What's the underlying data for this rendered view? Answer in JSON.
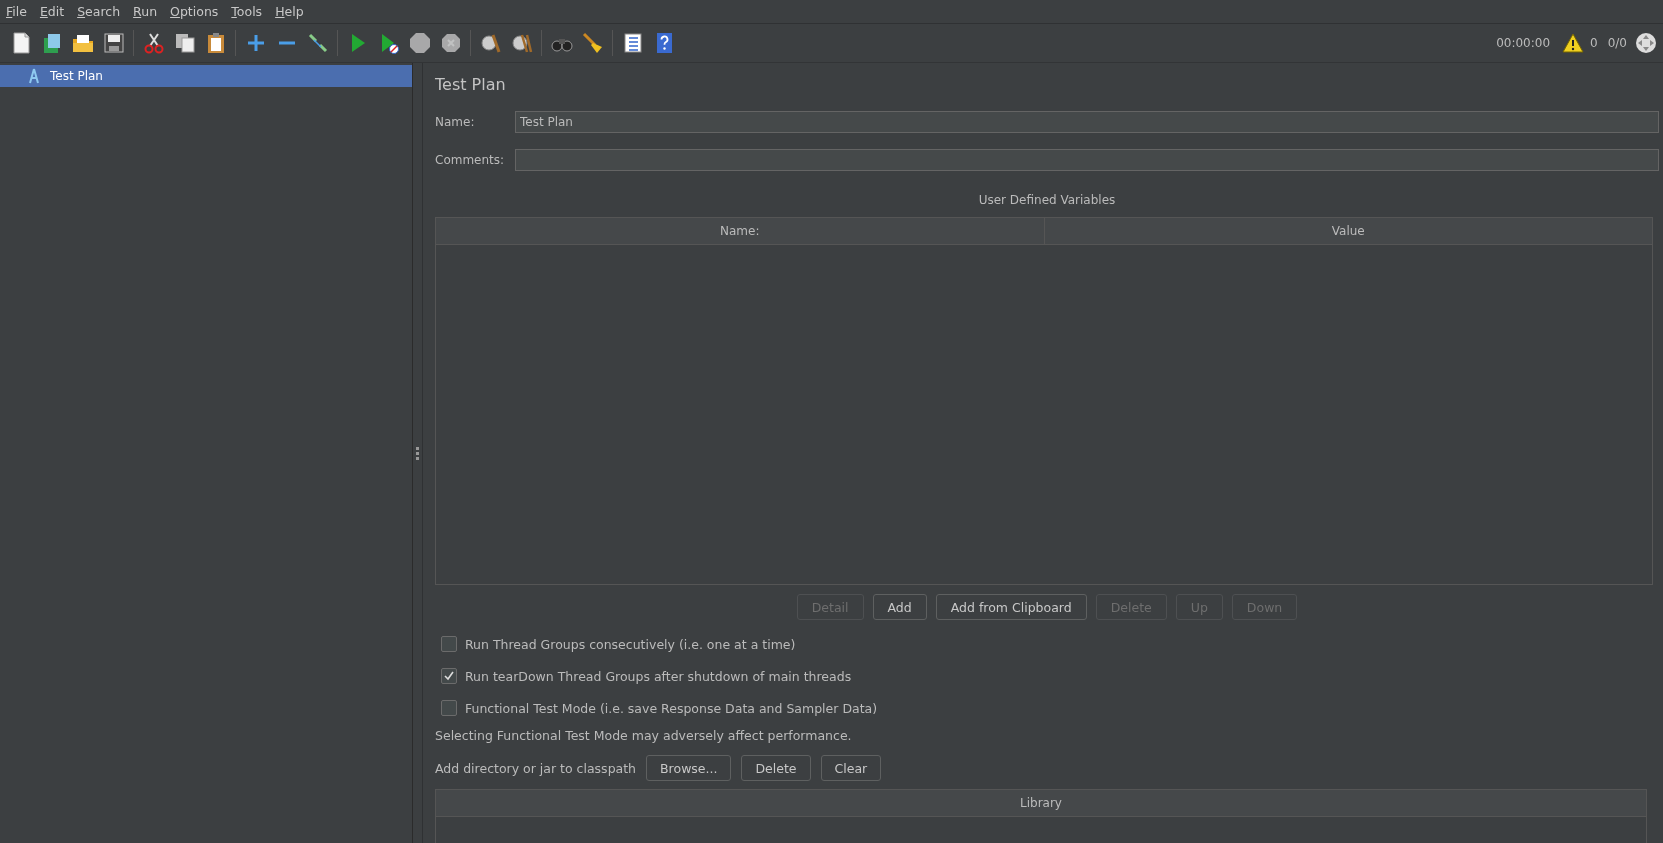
{
  "menu": [
    {
      "label": "File"
    },
    {
      "label": "Edit"
    },
    {
      "label": "Search"
    },
    {
      "label": "Run"
    },
    {
      "label": "Options"
    },
    {
      "label": "Tools"
    },
    {
      "label": "Help"
    }
  ],
  "toolbar": [
    [
      {
        "kind": "new",
        "disabled": false
      },
      {
        "kind": "templates",
        "disabled": false
      },
      {
        "kind": "open",
        "disabled": false
      },
      {
        "kind": "save",
        "disabled": false
      }
    ],
    [
      {
        "kind": "cut",
        "disabled": false
      },
      {
        "kind": "copy",
        "disabled": false
      },
      {
        "kind": "paste",
        "disabled": false
      }
    ],
    [
      {
        "kind": "expand",
        "disabled": false
      },
      {
        "kind": "collapse",
        "disabled": false
      },
      {
        "kind": "toggle",
        "disabled": false
      }
    ],
    [
      {
        "kind": "start",
        "disabled": false
      },
      {
        "kind": "start-no-timers",
        "disabled": false
      },
      {
        "kind": "stop",
        "disabled": true
      },
      {
        "kind": "shutdown",
        "disabled": true
      }
    ],
    [
      {
        "kind": "clear",
        "disabled": false
      },
      {
        "kind": "clear-all",
        "disabled": false
      }
    ],
    [
      {
        "kind": "search",
        "disabled": false
      },
      {
        "kind": "reset-search",
        "disabled": false
      }
    ],
    [
      {
        "kind": "function-helper",
        "disabled": false
      },
      {
        "kind": "help",
        "disabled": false
      }
    ]
  ],
  "status": {
    "timer": "00:00:00",
    "warnings": "0",
    "threads": "0/0"
  },
  "tree": [
    {
      "label": "Test Plan",
      "selected": true
    }
  ],
  "panel": {
    "title": "Test Plan",
    "name_field": {
      "label": "Name:",
      "value": "Test Plan"
    },
    "comments_field": {
      "label": "Comments:"
    },
    "variables": {
      "title": "User Defined Variables",
      "columns": [
        "Name:",
        "Value"
      ]
    },
    "buttons": [
      {
        "label": "Detail",
        "disabled": true
      },
      {
        "label": "Add",
        "disabled": false
      },
      {
        "label": "Add from Clipboard",
        "disabled": false
      },
      {
        "label": "Delete",
        "disabled": true
      },
      {
        "label": "Up",
        "disabled": true
      },
      {
        "label": "Down",
        "disabled": true
      }
    ],
    "options": [
      {
        "label": "Run Thread Groups consecutively (i.e. one at a time)",
        "checked": false
      },
      {
        "label": "Run tearDown Thread Groups after shutdown of main threads",
        "checked": true
      },
      {
        "label": "Functional Test Mode (i.e. save Response Data and Sampler Data)",
        "checked": false
      }
    ],
    "note": "Selecting Functional Test Mode may adversely affect performance.",
    "classpath": {
      "label": "Add directory or jar to classpath",
      "buttons": [
        {
          "label": "Browse...",
          "disabled": false
        },
        {
          "label": "Delete",
          "disabled": false
        },
        {
          "label": "Clear",
          "disabled": false
        }
      ]
    },
    "library": {
      "columns": [
        "Library"
      ]
    }
  }
}
